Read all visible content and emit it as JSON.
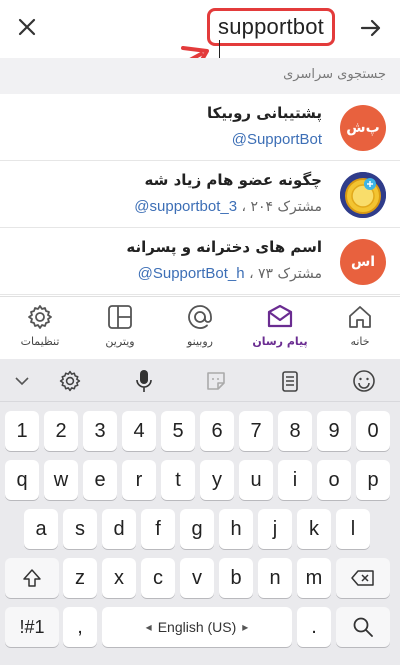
{
  "search": {
    "value": "supportbot"
  },
  "section": {
    "title": "جستجوی سراسری"
  },
  "results": [
    {
      "avatar_text": "پ‌ش",
      "avatar_color": "#e8613e",
      "title": "پشتیبانی روبیکا",
      "meta": "",
      "handle": "@SupportBot"
    },
    {
      "avatar_text": "",
      "avatar_color": "#f1c331",
      "title": "چگونه عضو هام زیاد شه",
      "meta": "مشترک ۲۰۴ ،",
      "handle": "@supportbot_3"
    },
    {
      "avatar_text": "اس",
      "avatar_color": "#e8613e",
      "title": "اسم های دخترانه و پسرانه",
      "meta": "مشترک ۷۳ ،",
      "handle": "@SupportBot_h"
    }
  ],
  "nav": [
    {
      "label": "تنظیمات",
      "icon": "gear-icon"
    },
    {
      "label": "ویترین",
      "icon": "layout-icon"
    },
    {
      "label": "روبینو",
      "icon": "at-icon"
    },
    {
      "label": "پیام رسان",
      "icon": "mail-icon",
      "active": true
    },
    {
      "label": "خانه",
      "icon": "home-icon"
    }
  ],
  "keyboard": {
    "row_numbers": [
      "1",
      "2",
      "3",
      "4",
      "5",
      "6",
      "7",
      "8",
      "9",
      "0"
    ],
    "row1": [
      "q",
      "w",
      "e",
      "r",
      "t",
      "y",
      "u",
      "i",
      "o",
      "p"
    ],
    "row2": [
      "a",
      "s",
      "d",
      "f",
      "g",
      "h",
      "j",
      "k",
      "l"
    ],
    "row3": [
      "z",
      "x",
      "c",
      "v",
      "b",
      "n",
      "m"
    ],
    "symbols_label": "!#1",
    "comma": ",",
    "space_label": "English (US)",
    "space_arrows": [
      "◂",
      "▸"
    ],
    "period": "."
  },
  "colors": {
    "accent": "#6a2c91",
    "annotation": "#e33b3b"
  }
}
